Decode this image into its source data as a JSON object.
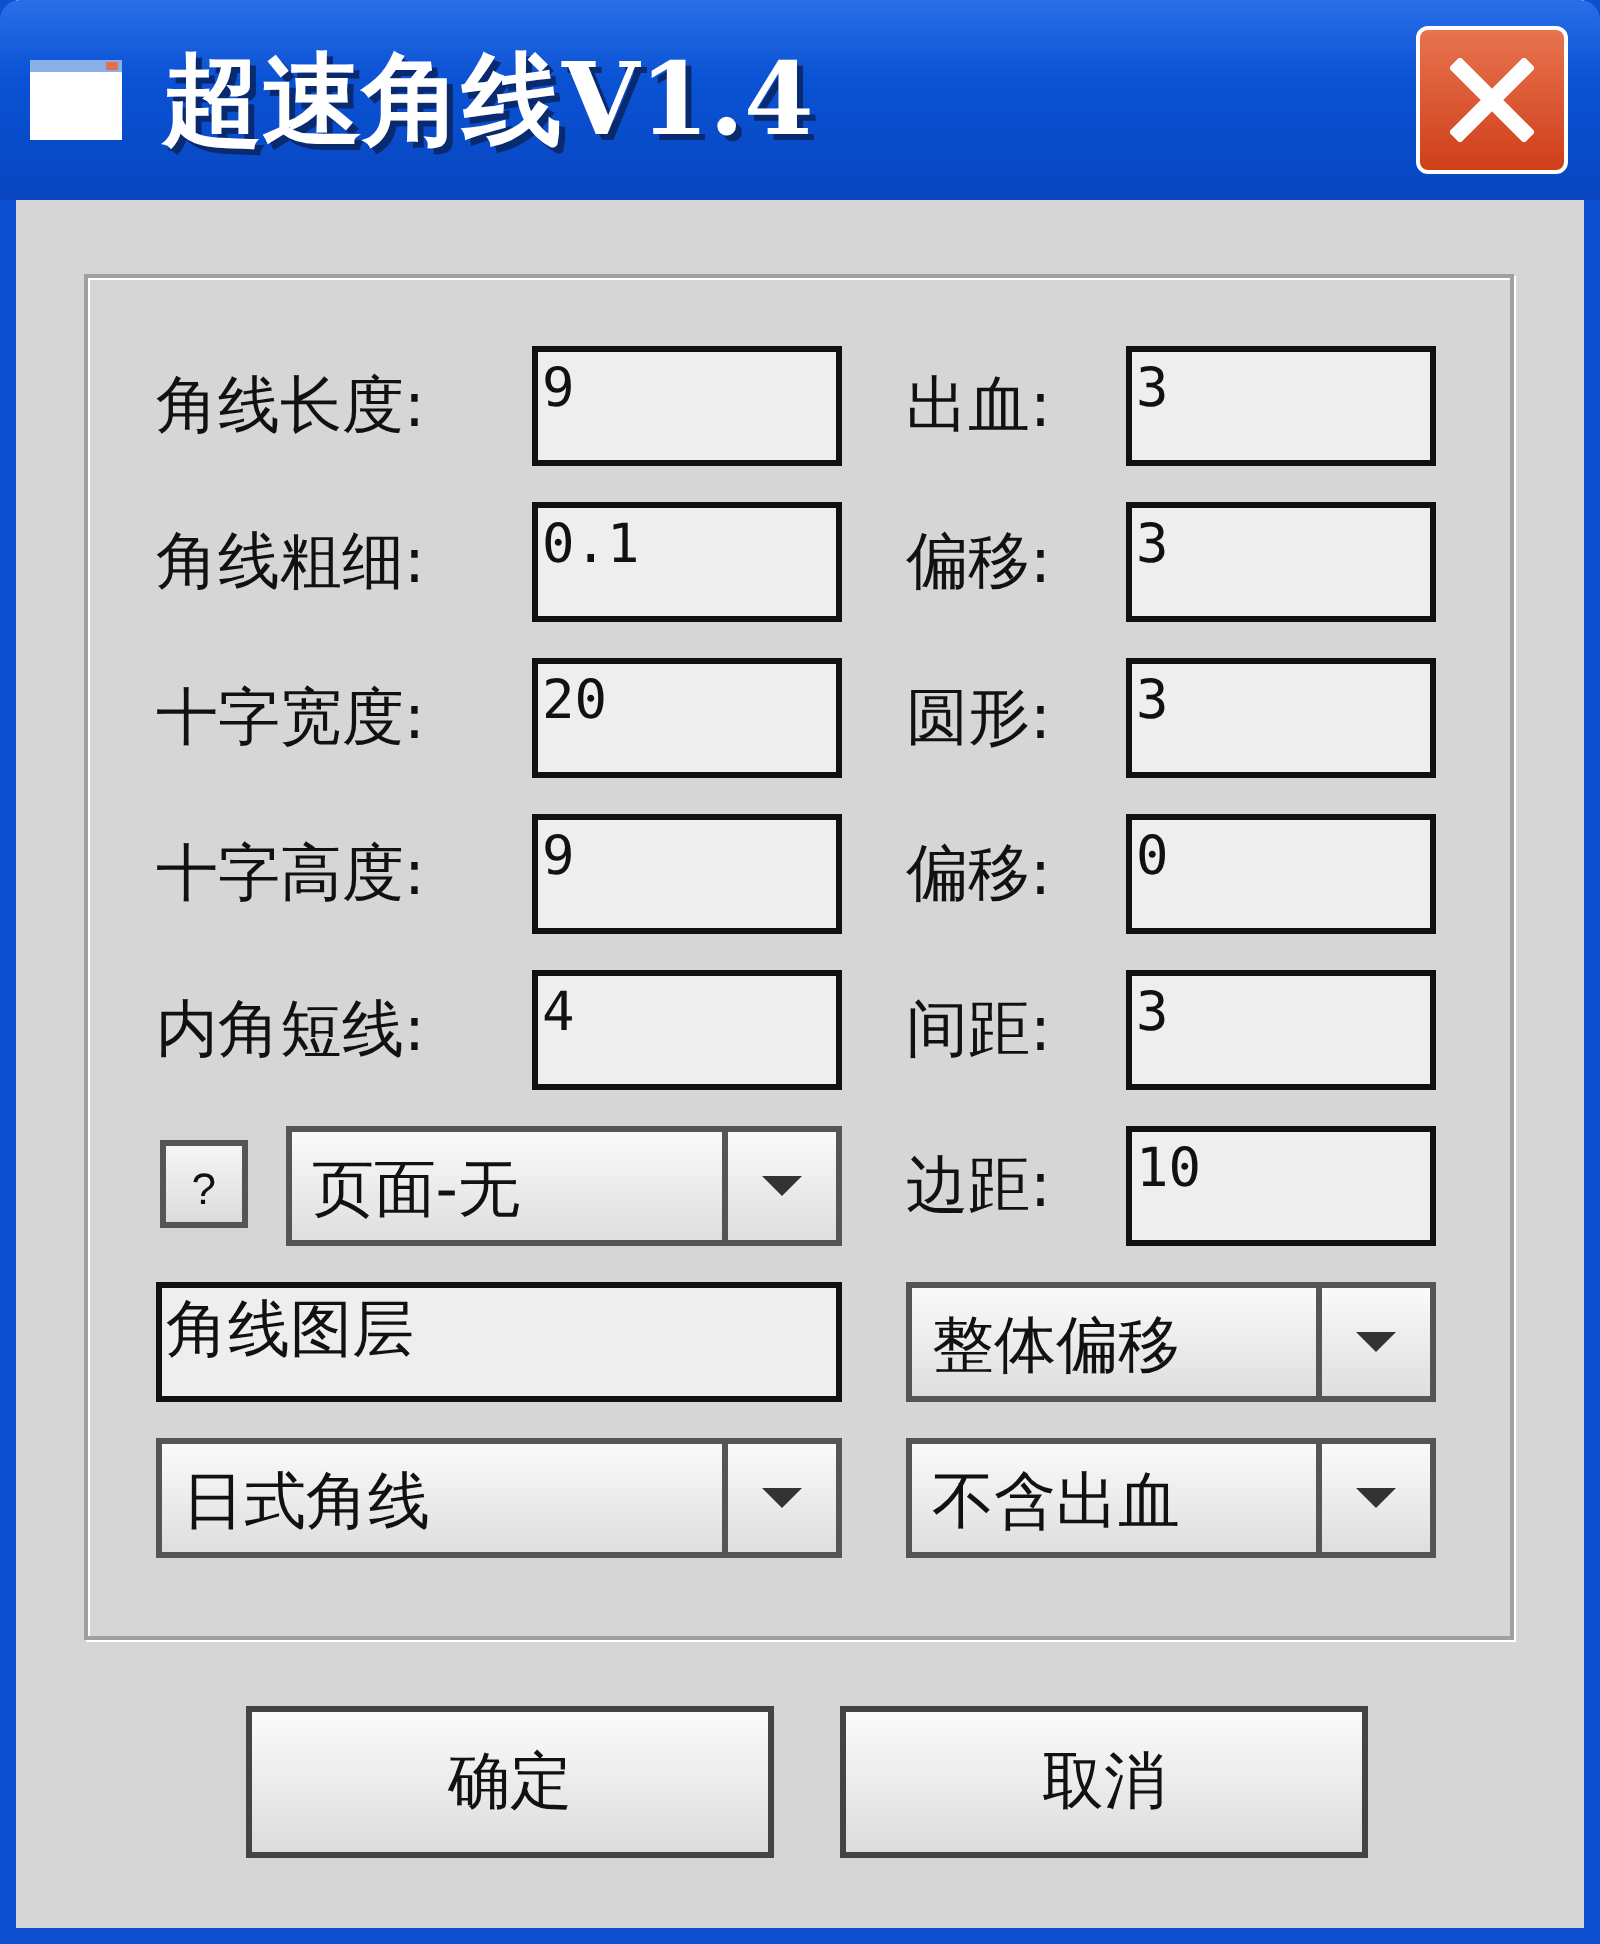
{
  "window": {
    "title": "超速角线V1.4"
  },
  "left_fields": [
    {
      "label": "角线长度:",
      "value": "9"
    },
    {
      "label": "角线粗细:",
      "value": "0.1"
    },
    {
      "label": "十字宽度:",
      "value": "20"
    },
    {
      "label": "十字高度:",
      "value": "9"
    },
    {
      "label": "内角短线:",
      "value": "4"
    }
  ],
  "right_fields": [
    {
      "label": "出血:",
      "value": "3"
    },
    {
      "label": "偏移:",
      "value": "3"
    },
    {
      "label": "圆形:",
      "value": "3"
    },
    {
      "label": "偏移:",
      "value": "0"
    },
    {
      "label": "间距:",
      "value": "3"
    },
    {
      "label": "边距:",
      "value": "10"
    }
  ],
  "help_button": "?",
  "page_dropdown": {
    "value": "页面-无"
  },
  "layer_field": {
    "value": "角线图层"
  },
  "offset_dropdown": {
    "value": "整体偏移"
  },
  "style_dropdown": {
    "value": "日式角线"
  },
  "bleed_dropdown": {
    "value": "不含出血"
  },
  "buttons": [
    "确定",
    "取消"
  ]
}
